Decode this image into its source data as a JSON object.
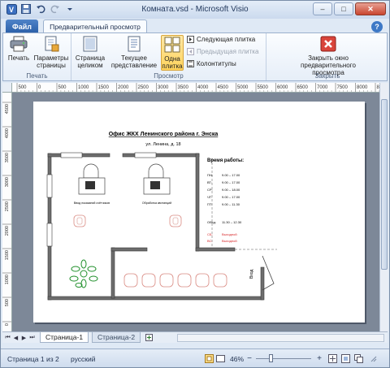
{
  "window": {
    "title": "Комната.vsd - Microsoft Visio",
    "minimize": "–",
    "maximize": "□",
    "close": "✕"
  },
  "tabs": {
    "file": "Файл",
    "preview": "Предварительный просмотр",
    "help": "?"
  },
  "ribbon": {
    "groups": {
      "print": "Печать",
      "view": "Просмотр",
      "close": "Закрыть"
    },
    "print_label": "Печать",
    "page_setup_label": "Параметры страницы",
    "whole_page_label": "Страница целиком",
    "current_view_label": "Текущее представление",
    "single_tile_label": "Одна плитка",
    "next_tile_label": "Следующая плитка",
    "prev_tile_label": "Предыдущая плитка",
    "headers_label": "Колонтитулы",
    "close_preview_label": "Закрыть окно предварительного просмотра"
  },
  "ruler": {
    "h_ticks": [
      "500",
      "0",
      "500",
      "1000",
      "1500",
      "2000",
      "2500",
      "3000",
      "3500",
      "4000",
      "4500",
      "5000",
      "5500",
      "6000",
      "6500",
      "7000",
      "7500",
      "8000",
      "8500"
    ],
    "v_ticks": [
      "4500",
      "4000",
      "3500",
      "3000",
      "2500",
      "2000",
      "1500",
      "1000",
      "500",
      "0"
    ]
  },
  "drawing": {
    "title": "Офис ЖКХ Ленинского района г. Энска",
    "address": "ул. Ленина, д. 18",
    "schedule_title": "Время работы:",
    "schedule": [
      {
        "day": "ПН:",
        "hours": "9.00 – 17.00"
      },
      {
        "day": "ВТ:",
        "hours": "9.00 – 17.00"
      },
      {
        "day": "СР:",
        "hours": "9.00 – 18.00"
      },
      {
        "day": "ЧТ:",
        "hours": "9.00 – 17.00"
      },
      {
        "day": "ПТ:",
        "hours": "9.00 – 11.30"
      }
    ],
    "lunch_label": "Обед:",
    "lunch_hours": "11.30 – 12.30",
    "weekend": [
      {
        "day": "СБ:",
        "text": "Выходной"
      },
      {
        "day": "ВС:",
        "text": "Выходной"
      }
    ],
    "desk1_label": "Ввод показаний счётчиков",
    "desk2_label": "Обработка квитанций",
    "entrance_label": "Вход",
    "weekend_color": "#d8282a"
  },
  "page_tabs": [
    "Страница-1",
    "Страница-2"
  ],
  "status": {
    "page_info": "Страница 1 из 2",
    "language": "русский",
    "zoom": "46%"
  }
}
